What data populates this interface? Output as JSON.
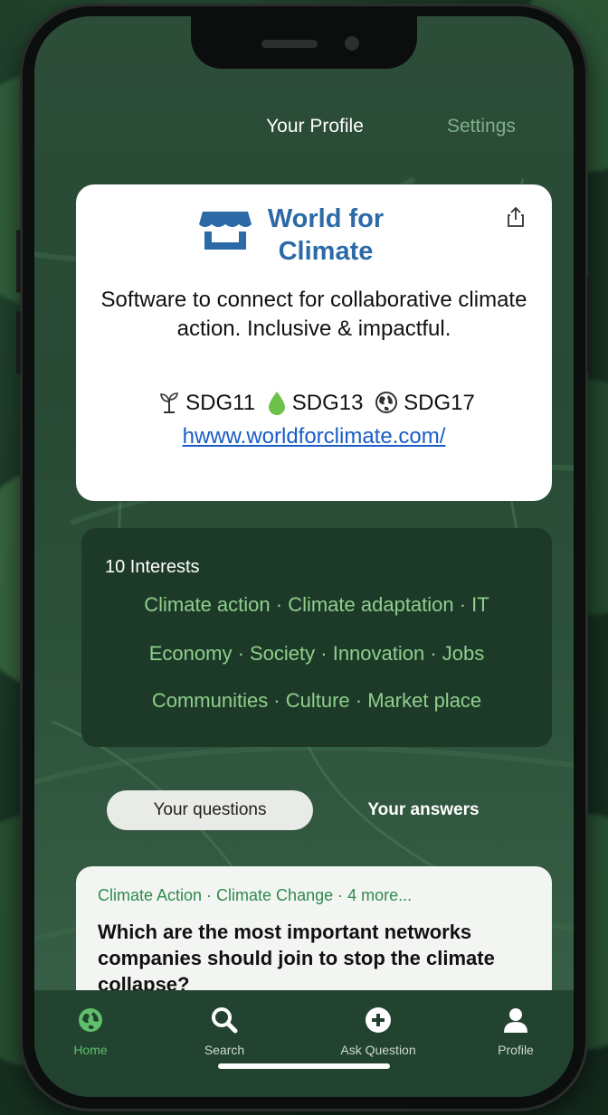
{
  "header": {
    "title": "Your Profile",
    "settings": "Settings"
  },
  "profile_card": {
    "title": "World for Climate",
    "description": "Software to connect for collaborative climate action. Inclusive & impactful.",
    "sdgs": [
      "SDG11",
      "SDG13",
      "SDG17"
    ],
    "link": "hwww.worldforclimate.com/",
    "icons": [
      "shop-icon",
      "share-icon",
      "sprout-icon",
      "water-drop-icon",
      "globe-icon"
    ]
  },
  "interests": {
    "count_label": "10  Interests",
    "lines": [
      "Climate action · Climate adaptation · IT",
      "Economy · Society · Innovation · Jobs",
      "Communities · Culture · Market place"
    ]
  },
  "tabs": {
    "questions": "Your questions",
    "answers": "Your answers",
    "active": "questions"
  },
  "question_card": {
    "tags": "Climate Action  ·  Climate Change  ·  4 more...",
    "title": "Which are the most important networks companies should join to stop the climate collapse?"
  },
  "tabbar": {
    "items": [
      {
        "label": "Home",
        "icon": "globe-icon",
        "active": true
      },
      {
        "label": "Search",
        "icon": "search-icon",
        "active": false
      },
      {
        "label": "Ask Question",
        "icon": "plus-circle-icon",
        "active": false
      },
      {
        "label": "Profile",
        "icon": "person-icon",
        "active": false
      }
    ]
  },
  "colors": {
    "accent_green": "#5fbf6a",
    "interest_text": "#8fcf8c",
    "title_blue": "#2b6aa6",
    "link_blue": "#1a5cc8",
    "tab_bar": "#214330"
  }
}
